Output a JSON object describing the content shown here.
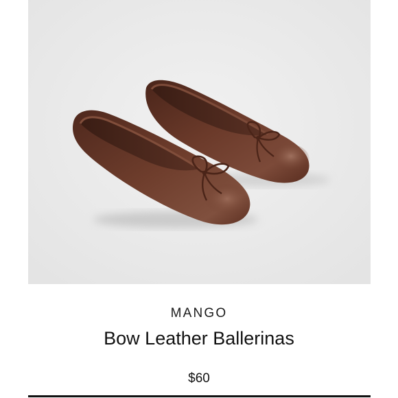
{
  "product": {
    "image_alt": "Brown leather ballet flats with bow",
    "brand": "MANGO",
    "name": "Bow Leather Ballerinas",
    "price": "$60",
    "colors": {
      "leather": "#5a2e20",
      "leather_highlight": "#8a5a48",
      "background": "#ececec"
    }
  }
}
